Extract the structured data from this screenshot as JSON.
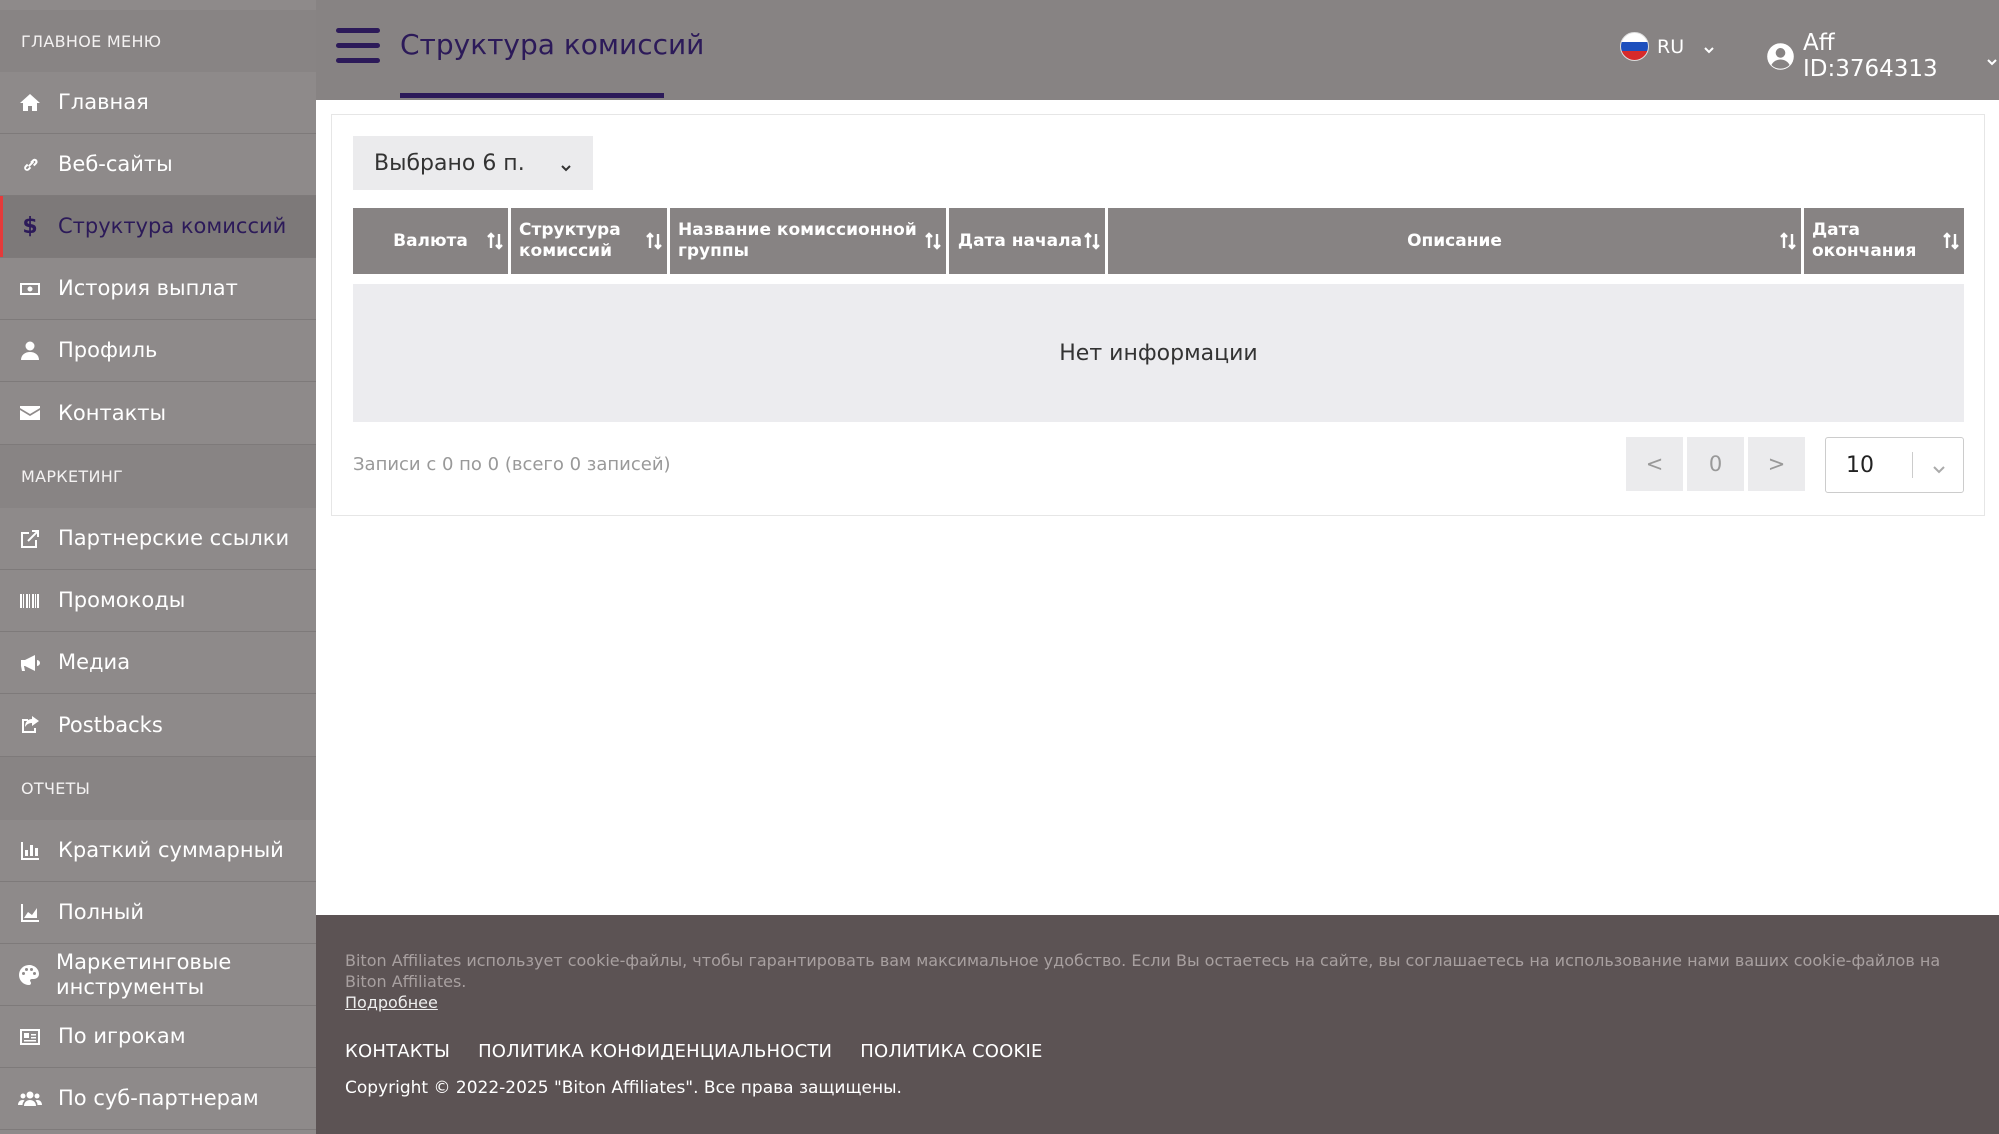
{
  "sidebar": {
    "sections": [
      {
        "title": "ГЛАВНОЕ МЕНЮ",
        "items": [
          {
            "label": "Главная",
            "icon": "home-icon"
          },
          {
            "label": "Веб-сайты",
            "icon": "link-icon"
          },
          {
            "label": "Структура комиссий",
            "icon": "dollar-icon",
            "active": true
          },
          {
            "label": "История выплат",
            "icon": "money-bill-icon"
          },
          {
            "label": "Профиль",
            "icon": "user-icon"
          },
          {
            "label": "Контакты",
            "icon": "envelope-icon"
          }
        ]
      },
      {
        "title": "МАРКЕТИНГ",
        "items": [
          {
            "label": "Партнерские ссылки",
            "icon": "external-link-icon"
          },
          {
            "label": "Промокоды",
            "icon": "barcode-icon"
          },
          {
            "label": "Медиа",
            "icon": "megaphone-icon"
          },
          {
            "label": "Postbacks",
            "icon": "share-icon"
          }
        ]
      },
      {
        "title": "ОТЧЕТЫ",
        "items": [
          {
            "label": "Краткий суммарный",
            "icon": "bar-chart-icon"
          },
          {
            "label": "Полный",
            "icon": "area-chart-icon"
          },
          {
            "label": "Маркетинговые инструменты",
            "icon": "palette-icon"
          },
          {
            "label": "По игрокам",
            "icon": "id-card-icon"
          },
          {
            "label": "По суб-партнерам",
            "icon": "users-icon"
          }
        ]
      }
    ]
  },
  "header": {
    "title": "Структура комиссий",
    "language": "RU",
    "account": "Aff ID:3764313"
  },
  "filter": {
    "selected_label": "Выбрано 6 п."
  },
  "table": {
    "columns": [
      "Валюта",
      "Структура комиссий",
      "Название комиссионной группы",
      "Дата начала",
      "Описание",
      "Дата окончания"
    ],
    "empty_text": "Нет информации"
  },
  "pagination": {
    "records_info": "Записи с 0 по 0 (всего 0 записей)",
    "prev_label": "<",
    "current_page": "0",
    "next_label": ">",
    "page_size": "10"
  },
  "footer": {
    "cookie_text": "Biton Affiliates использует cookie-файлы, чтобы гарантировать вам максимальное удобство. Если Вы остаетесь на сайте, вы соглашаетесь на использование нами ваших cookie-файлов на Biton Affiliates.",
    "more_link": "Подробнее",
    "links": [
      "КОНТАКТЫ",
      "ПОЛИТИКА КОНФИДЕНЦИАЛЬНОСТИ",
      "ПОЛИТИКА COOKIE"
    ],
    "copyright": "Copyright © 2022-2025 \"Biton Affiliates\". Все права защищены."
  },
  "colors": {
    "sidebar_bg": "#8e8a8a",
    "header_bg": "#878383",
    "accent": "#2c1a59",
    "active_marker": "#e53a3a",
    "footer_bg": "#5c5354"
  }
}
